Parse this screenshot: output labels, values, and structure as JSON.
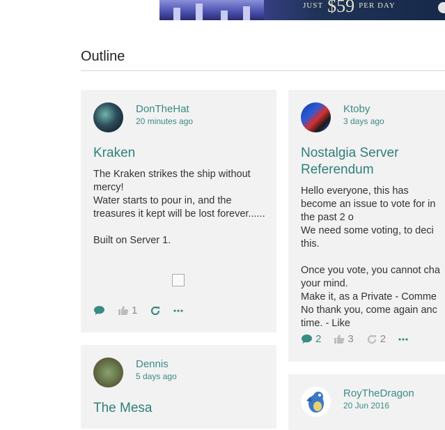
{
  "banner": {
    "promo_small_left": "JUST",
    "promo_big": "$59",
    "promo_small_right": "PER DAY"
  },
  "section": {
    "title": "Outline"
  },
  "posts": [
    {
      "author": "DonTheHat",
      "time": "20 minutes ago",
      "title": "Kraken",
      "body_lines": [
        "The Kraken strikes the ship without mercy!",
        "Water starts to pour in, and the treasures it kept will be lost forever......",
        "",
        "Built on Server 1."
      ],
      "likes": "1",
      "comments": "",
      "reshares": ""
    },
    {
      "author": "Ktoby",
      "time": "3 days ago",
      "title": "Nostalgia Server Referendum",
      "body_lines": [
        "Hello everyone, this has become an issue to vote for in the past 2 o",
        "We need some voting, to deci this.",
        "",
        "Once you vote, you cannot cha your mind.",
        "Make it, as a Private - Comme",
        "No thank you, come again anc time. - Like"
      ],
      "comments": "2",
      "likes": "3",
      "reshares": "2"
    },
    {
      "author": "Dennis",
      "time": "5 days ago",
      "title": "The Mesa"
    },
    {
      "author": "RoyTheDragon",
      "time": "20 Jun 2016"
    }
  ]
}
